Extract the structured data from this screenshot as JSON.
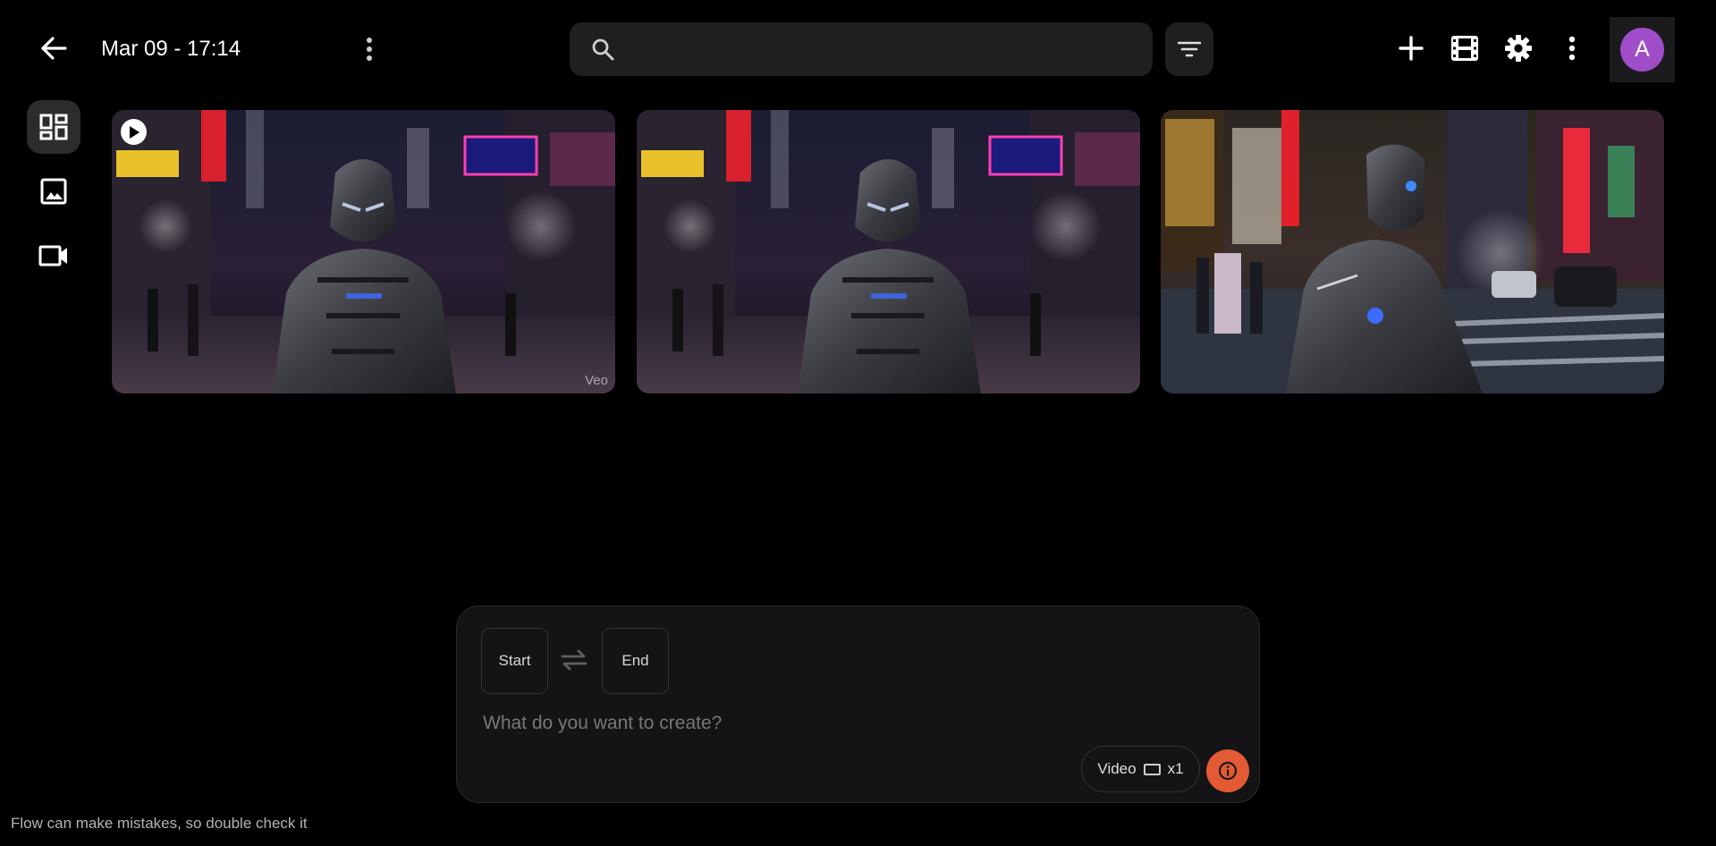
{
  "header": {
    "title": "Mar 09 - 17:14",
    "search_placeholder": "",
    "accent_color": "#a04dc9"
  },
  "toolbar": {
    "avatar_letter": "A"
  },
  "rail": {
    "items": [
      {
        "name": "grid-view",
        "icon": "dashboard-icon",
        "active": true
      },
      {
        "name": "images",
        "icon": "image-icon",
        "active": false
      },
      {
        "name": "videos",
        "icon": "video-camera-icon",
        "active": false
      }
    ]
  },
  "gallery": {
    "items": [
      {
        "kind": "video",
        "watermark": "Veo"
      },
      {
        "kind": "image"
      },
      {
        "kind": "image"
      }
    ]
  },
  "composer": {
    "start_label": "Start",
    "end_label": "End",
    "prompt_placeholder": "What do you want to create?",
    "mode_label": "Video",
    "count_label": "x1",
    "submit_color": "#e35a35"
  },
  "footer": {
    "disclaimer": "Flow can make mistakes, so double check it"
  }
}
